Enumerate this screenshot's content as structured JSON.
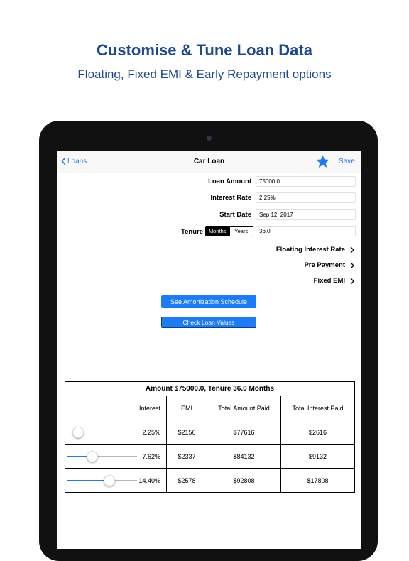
{
  "promo": {
    "title": "Customise & Tune Loan Data",
    "subtitle": "Floating, Fixed EMI & Early Repayment options"
  },
  "nav": {
    "back_label": "Loans",
    "title": "Car Loan",
    "save_label": "Save",
    "star_color": "#1a7cf6"
  },
  "form": {
    "loan_amount": {
      "label": "Loan Amount",
      "value": "75000.0"
    },
    "interest_rate": {
      "label": "Interest Rate",
      "value": "2.25%"
    },
    "start_date": {
      "label": "Start Date",
      "value": "Sep 12, 2017"
    },
    "tenure": {
      "label": "Tenure",
      "options": [
        "Months",
        "Years"
      ],
      "selected": "Months",
      "value": "36.0"
    }
  },
  "links": {
    "floating": "Floating Interest Rate",
    "prepayment": "Pre Payment",
    "fixed_emi": "Fixed EMI"
  },
  "buttons": {
    "amortization": "See Amortization Schedule",
    "check_values": "Check Loan Values"
  },
  "table": {
    "caption": "Amount $75000.0, Tenure 36.0 Months",
    "headers": {
      "interest": "Interest",
      "emi": "EMI",
      "total_paid": "Total Amount Paid",
      "total_interest": "Total Interest Paid"
    },
    "rows": [
      {
        "interest": "2.25%",
        "emi": "$2156",
        "total_paid": "$77616",
        "total_interest": "$2616",
        "slider_fraction": 0.14
      },
      {
        "interest": "7.62%",
        "emi": "$2337",
        "total_paid": "$84132",
        "total_interest": "$9132",
        "slider_fraction": 0.35
      },
      {
        "interest": "14.40%",
        "emi": "$2578",
        "total_paid": "$92808",
        "total_interest": "$17808",
        "slider_fraction": 0.59
      }
    ]
  },
  "colors": {
    "accent": "#1a7cf6",
    "promo_text": "#1d4a8c"
  }
}
